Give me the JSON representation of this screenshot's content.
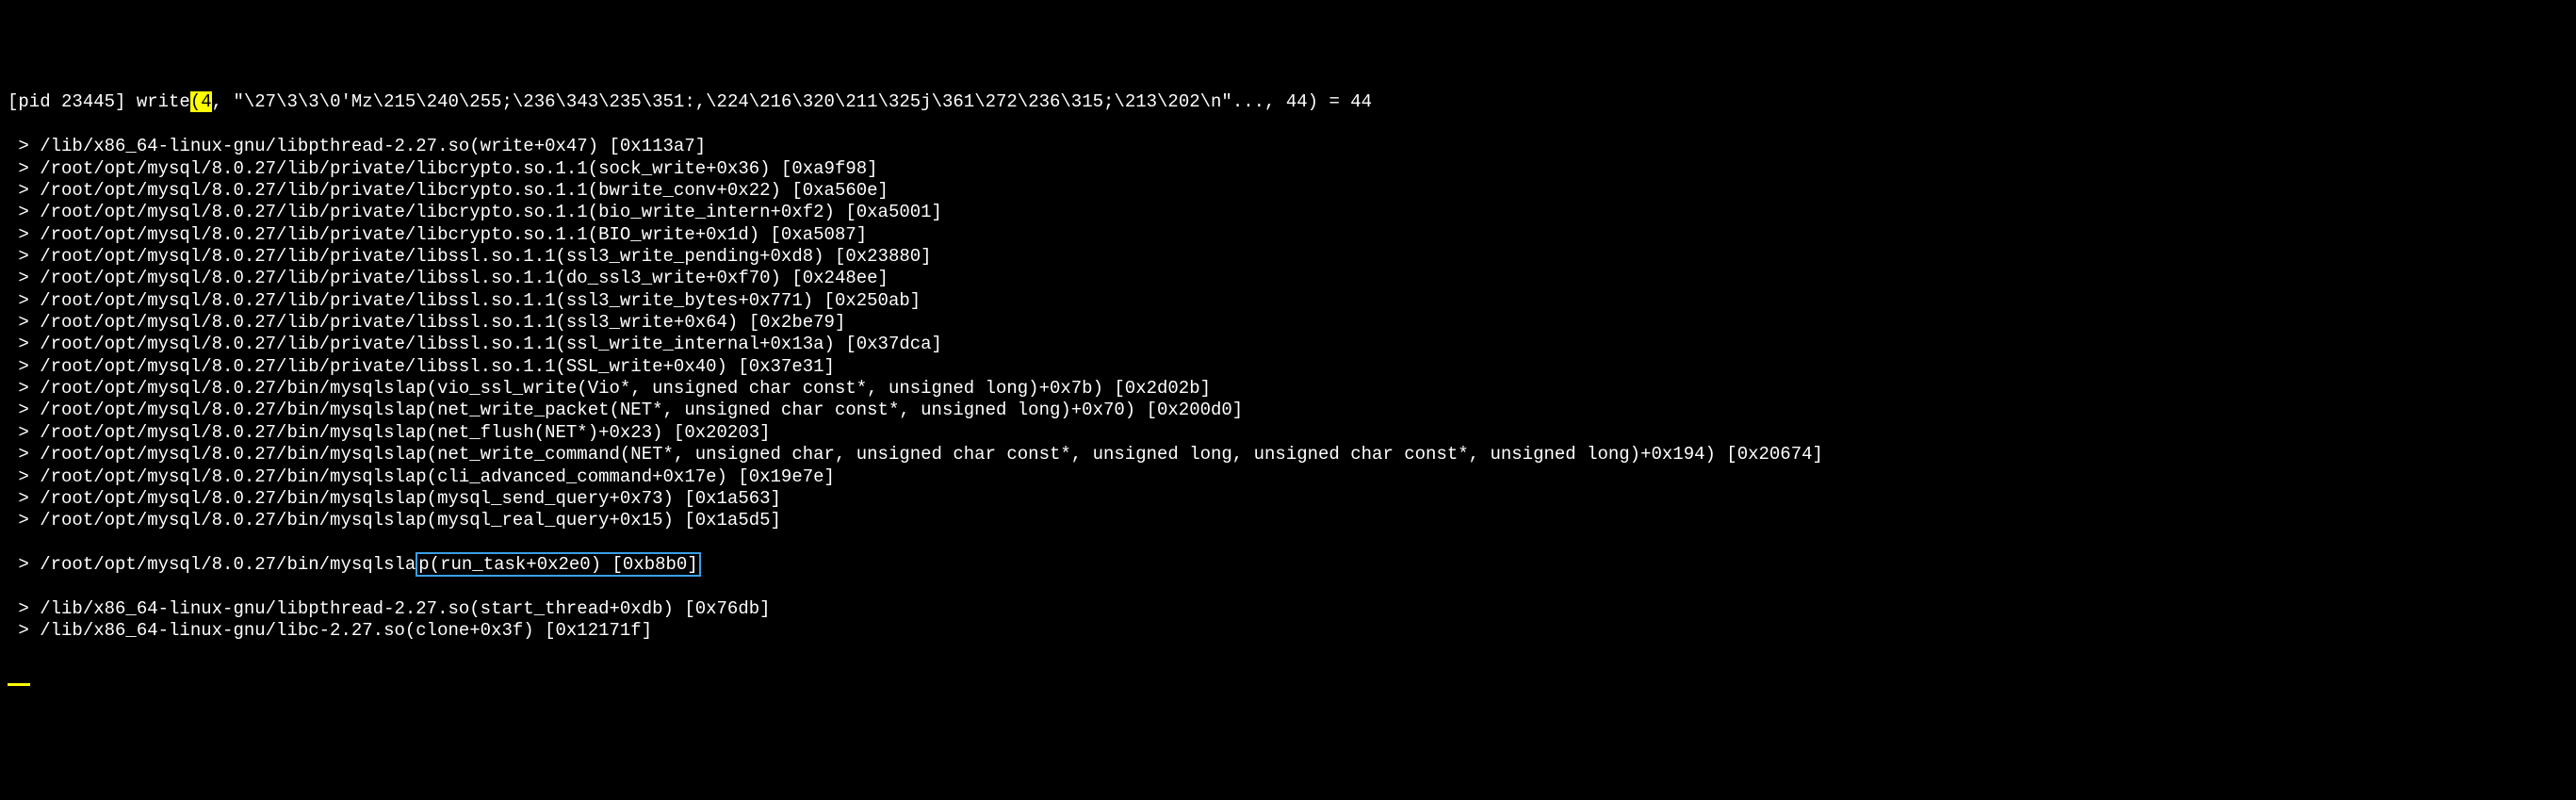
{
  "trace": {
    "header": {
      "pid_label": "[pid 23445] write",
      "fd_highlight": "(4",
      "rest": ", \"\\27\\3\\3\\0'Mz\\215\\240\\255;\\236\\343\\235\\351:,\\224\\216\\320\\211\\325j\\361\\272\\236\\315;\\213\\202\\n\"..., 44) = 44"
    },
    "lines": [
      " > /lib/x86_64-linux-gnu/libpthread-2.27.so(write+0x47) [0x113a7]",
      " > /root/opt/mysql/8.0.27/lib/private/libcrypto.so.1.1(sock_write+0x36) [0xa9f98]",
      " > /root/opt/mysql/8.0.27/lib/private/libcrypto.so.1.1(bwrite_conv+0x22) [0xa560e]",
      " > /root/opt/mysql/8.0.27/lib/private/libcrypto.so.1.1(bio_write_intern+0xf2) [0xa5001]",
      " > /root/opt/mysql/8.0.27/lib/private/libcrypto.so.1.1(BIO_write+0x1d) [0xa5087]",
      " > /root/opt/mysql/8.0.27/lib/private/libssl.so.1.1(ssl3_write_pending+0xd8) [0x23880]",
      " > /root/opt/mysql/8.0.27/lib/private/libssl.so.1.1(do_ssl3_write+0xf70) [0x248ee]",
      " > /root/opt/mysql/8.0.27/lib/private/libssl.so.1.1(ssl3_write_bytes+0x771) [0x250ab]",
      " > /root/opt/mysql/8.0.27/lib/private/libssl.so.1.1(ssl3_write+0x64) [0x2be79]",
      " > /root/opt/mysql/8.0.27/lib/private/libssl.so.1.1(ssl_write_internal+0x13a) [0x37dca]",
      " > /root/opt/mysql/8.0.27/lib/private/libssl.so.1.1(SSL_write+0x40) [0x37e31]",
      " > /root/opt/mysql/8.0.27/bin/mysqlslap(vio_ssl_write(Vio*, unsigned char const*, unsigned long)+0x7b) [0x2d02b]",
      " > /root/opt/mysql/8.0.27/bin/mysqlslap(net_write_packet(NET*, unsigned char const*, unsigned long)+0x70) [0x200d0]",
      " > /root/opt/mysql/8.0.27/bin/mysqlslap(net_flush(NET*)+0x23) [0x20203]",
      " > /root/opt/mysql/8.0.27/bin/mysqlslap(net_write_command(NET*, unsigned char, unsigned char const*, unsigned long, unsigned char const*, unsigned long)+0x194) [0x20674]",
      " > /root/opt/mysql/8.0.27/bin/mysqlslap(cli_advanced_command+0x17e) [0x19e7e]",
      " > /root/opt/mysql/8.0.27/bin/mysqlslap(mysql_send_query+0x73) [0x1a563]",
      " > /root/opt/mysql/8.0.27/bin/mysqlslap(mysql_real_query+0x15) [0x1a5d5]"
    ],
    "highlighted_line": {
      "prefix": " > /root/opt/mysql/8.0.27/bin/mysqlsla",
      "highlighted": "p(run_task+0x2e0) [0xb8b0]"
    },
    "tail_lines": [
      " > /lib/x86_64-linux-gnu/libpthread-2.27.so(start_thread+0xdb) [0x76db]",
      " > /lib/x86_64-linux-gnu/libc-2.27.so(clone+0x3f) [0x12171f]"
    ]
  }
}
